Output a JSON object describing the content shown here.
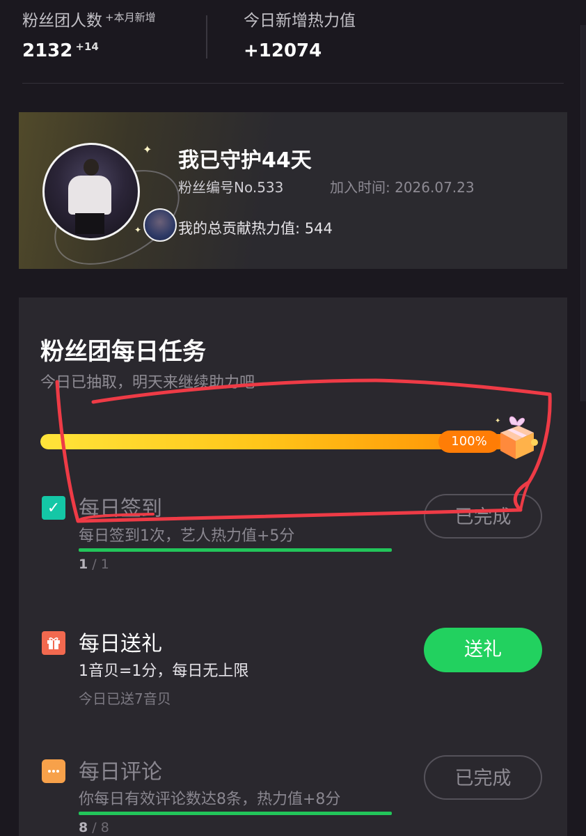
{
  "stats": {
    "fans_label": "粉丝团人数",
    "fans_month_label": "+本月新增",
    "fans_value": "2132",
    "fans_delta": "+14",
    "heat_label": "今日新增热力值",
    "heat_value": "+12074"
  },
  "profile": {
    "title": "我已守护44天",
    "fan_no": "粉丝编号No.533",
    "join_time": "加入时间: 2026.07.23",
    "total_heat": "我的总贡献热力值: 544"
  },
  "tasks": {
    "title": "粉丝团每日任务",
    "subtitle": "今日已抽取，明天来继续助力吧",
    "progress_label": "100%",
    "progress_value": 1.0,
    "items": [
      {
        "name": "每日签到",
        "desc": "每日签到1次，艺人热力值+5分",
        "count_done": "1",
        "count_total": "/ 1",
        "button": "已完成",
        "icon": "check-calendar-icon"
      },
      {
        "name": "每日送礼",
        "desc": "1音贝=1分，每日无上限",
        "extra": "今日已送7音贝",
        "button": "送礼",
        "icon": "gift-icon"
      },
      {
        "name": "每日评论",
        "desc": "你每日有效评论数达8条，热力值+8分",
        "count_done": "8",
        "count_total": "/ 8",
        "button": "已完成",
        "icon": "comment-icon"
      }
    ]
  },
  "colors": {
    "background": "#1b181f",
    "card": "#2a282e",
    "accent_green": "#22d15f",
    "progress_orange": "#ff7d06",
    "annotation_red": "#ee3b46"
  }
}
